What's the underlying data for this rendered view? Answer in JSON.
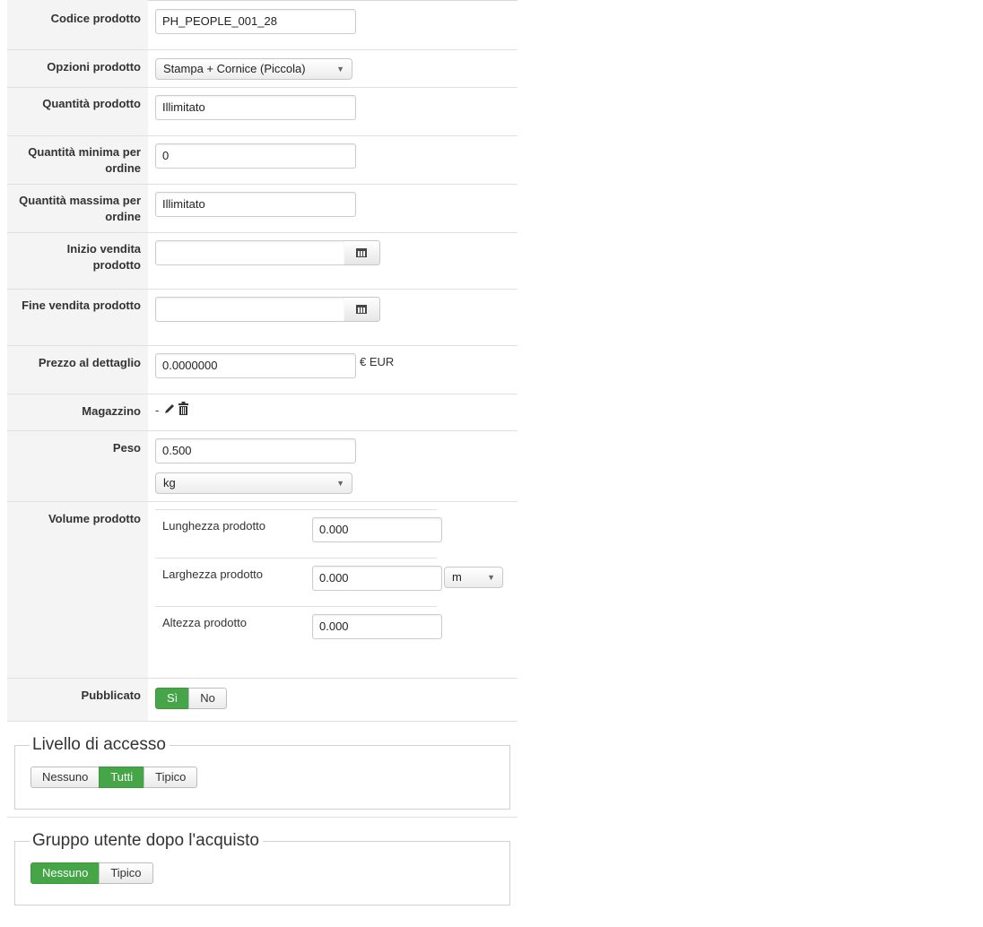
{
  "form": {
    "codice": {
      "label": "Codice prodotto",
      "value": "PH_PEOPLE_001_28"
    },
    "opzioni": {
      "label": "Opzioni prodotto",
      "value": "Stampa + Cornice (Piccola)"
    },
    "quantita": {
      "label": "Quantità prodotto",
      "value": "Illimitato"
    },
    "min_ordine": {
      "label": "Quantità minima per ordine",
      "value": "0"
    },
    "max_ordine": {
      "label": "Quantità massima per ordine",
      "value": "Illimitato"
    },
    "inizio_vendita": {
      "label": "Inizio vendita prodotto",
      "value": ""
    },
    "fine_vendita": {
      "label": "Fine vendita prodotto",
      "value": ""
    },
    "prezzo": {
      "label": "Prezzo al dettaglio",
      "value": "0.0000000",
      "currency": "€ EUR"
    },
    "magazzino": {
      "label": "Magazzino",
      "value": "-"
    },
    "peso": {
      "label": "Peso",
      "value": "0.500",
      "unit": "kg"
    },
    "volume": {
      "label": "Volume prodotto",
      "lunghezza_label": "Lunghezza prodotto",
      "lunghezza": "0.000",
      "larghezza_label": "Larghezza prodotto",
      "larghezza": "0.000",
      "altezza_label": "Altezza prodotto",
      "altezza": "0.000",
      "unit": "m"
    },
    "pubblicato": {
      "label": "Pubblicato",
      "yes": "Sì",
      "no": "No",
      "selected": "Sì"
    }
  },
  "access": {
    "legend": "Livello di accesso",
    "options": [
      "Nessuno",
      "Tutti",
      "Tipico"
    ],
    "selected": "Tutti"
  },
  "group": {
    "legend": "Gruppo utente dopo l'acquisto",
    "options": [
      "Nessuno",
      "Tipico"
    ],
    "selected": "Nessuno"
  },
  "colors": {
    "active": "#46a546",
    "label_bg": "#f4f4f4"
  },
  "icons": {
    "calendar": "calendar-icon",
    "edit": "pencil-icon",
    "delete": "trash-icon",
    "dropdown": "caret-down-icon"
  }
}
